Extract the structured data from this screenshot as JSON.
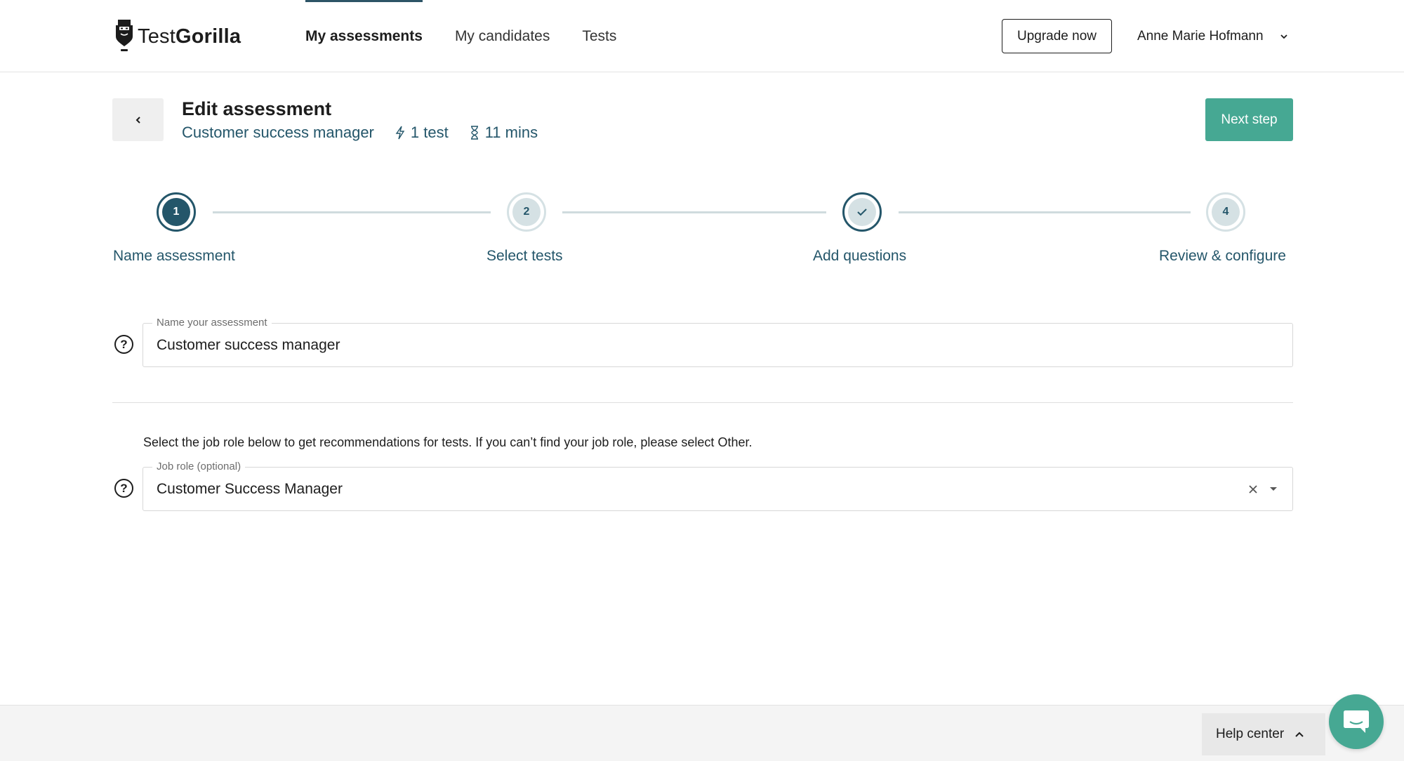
{
  "header": {
    "logo": {
      "part1": "Test",
      "part2": "Gorilla"
    },
    "nav": [
      {
        "label": "My assessments",
        "active": true
      },
      {
        "label": "My candidates",
        "active": false
      },
      {
        "label": "Tests",
        "active": false
      }
    ],
    "upgrade_label": "Upgrade now",
    "user_name": "Anne Marie Hofmann"
  },
  "assessment": {
    "title": "Edit assessment",
    "name": "Customer success manager",
    "tests_count": "1 test",
    "duration": "11 mins",
    "next_label": "Next step"
  },
  "steps": [
    {
      "number": "1",
      "label": "Name assessment",
      "state": "active"
    },
    {
      "number": "2",
      "label": "Select tests",
      "state": "pending"
    },
    {
      "number": "",
      "label": "Add questions",
      "state": "current"
    },
    {
      "number": "4",
      "label": "Review & configure",
      "state": "pending"
    }
  ],
  "form": {
    "name_field": {
      "label": "Name your assessment",
      "value": "Customer success manager"
    },
    "job_hint": "Select the job role below to get recommendations for tests. If you can’t find your job role, please select Other.",
    "job_field": {
      "label": "Job role (optional)",
      "value": "Customer Success Manager"
    },
    "help_glyph": "?"
  },
  "footer": {
    "help_center_label": "Help center"
  },
  "colors": {
    "primary": "#24566a",
    "accent": "#46a893"
  }
}
